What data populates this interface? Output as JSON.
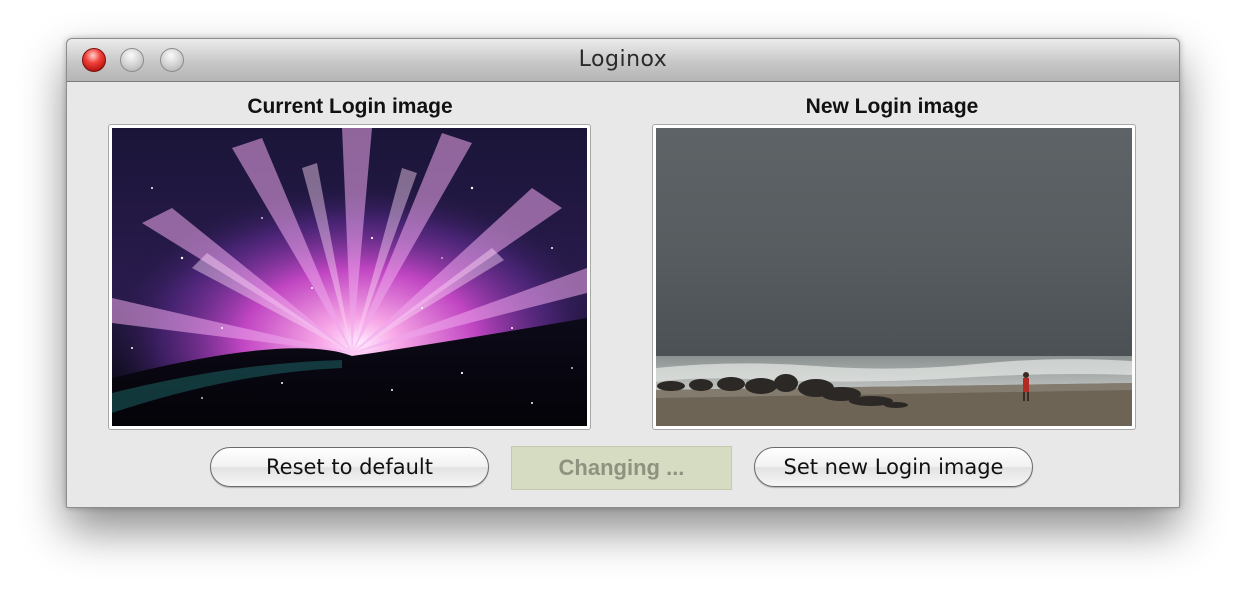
{
  "window": {
    "title": "Loginox"
  },
  "current_image": {
    "label": "Current Login image",
    "icon": "aurora-wallpaper-image"
  },
  "new_image": {
    "label": "New Login image",
    "icon": "stormy-beach-photo"
  },
  "buttons": {
    "reset_label": "Reset to default",
    "set_label": "Set new Login image"
  },
  "status": {
    "text": "Changing ..."
  },
  "colors": {
    "close_button": "#e43a35",
    "status_background": "#d6dcc2",
    "status_text": "#8e927f"
  }
}
